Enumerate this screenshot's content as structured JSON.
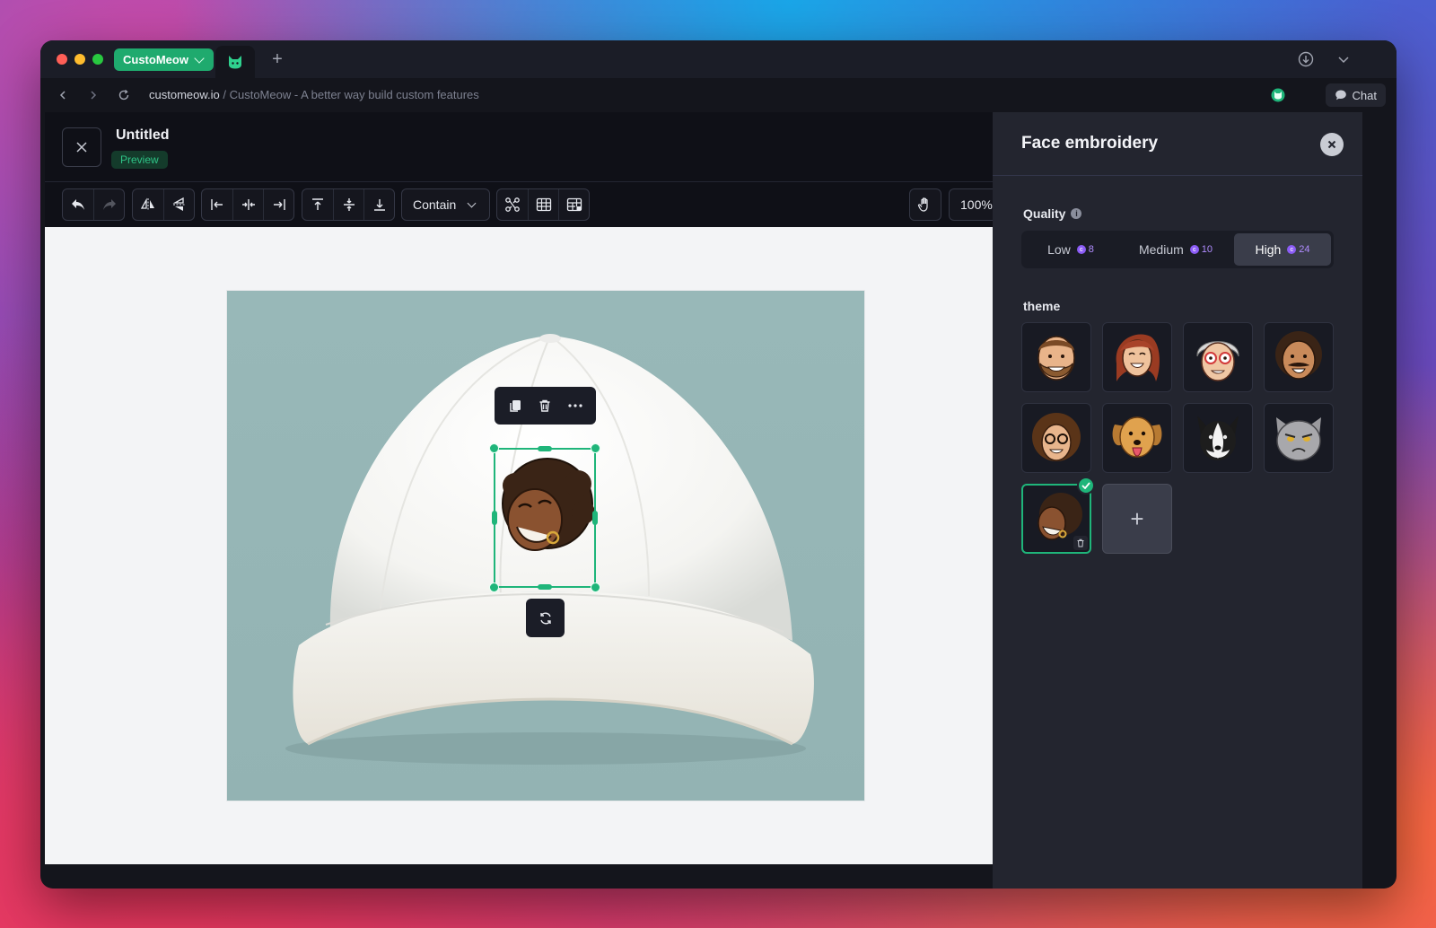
{
  "app": {
    "name": "CustoMeow",
    "url_domain": "customeow.io",
    "url_rest": " / CustoMeow - A better way build custom features",
    "chat_label": "Chat"
  },
  "document": {
    "title": "Untitled",
    "status": "Preview"
  },
  "toolbar": {
    "fit_mode": "Contain",
    "zoom": "100%"
  },
  "panel": {
    "title": "Face embroidery",
    "quality_label": "Quality",
    "quality_info": "i",
    "quality_options": [
      {
        "label": "Low",
        "cost": "8"
      },
      {
        "label": "Medium",
        "cost": "10"
      },
      {
        "label": "High",
        "cost": "24"
      }
    ],
    "quality_selected": "High",
    "theme_label": "theme",
    "themes": [
      "bearded-man-face",
      "smiling-woman-face",
      "grandma-with-glasses-face",
      "mustache-man-face",
      "curly-hair-woman-glasses-face",
      "golden-retriever-face",
      "border-collie-face",
      "grumpy-cat-face",
      "uploaded-afro-woman-face"
    ],
    "add_label": "+"
  },
  "colors": {
    "accent": "#1fb57a",
    "panel_bg": "#23252f",
    "editor_bg": "#0f1017",
    "coin": "#8b5cf6"
  }
}
